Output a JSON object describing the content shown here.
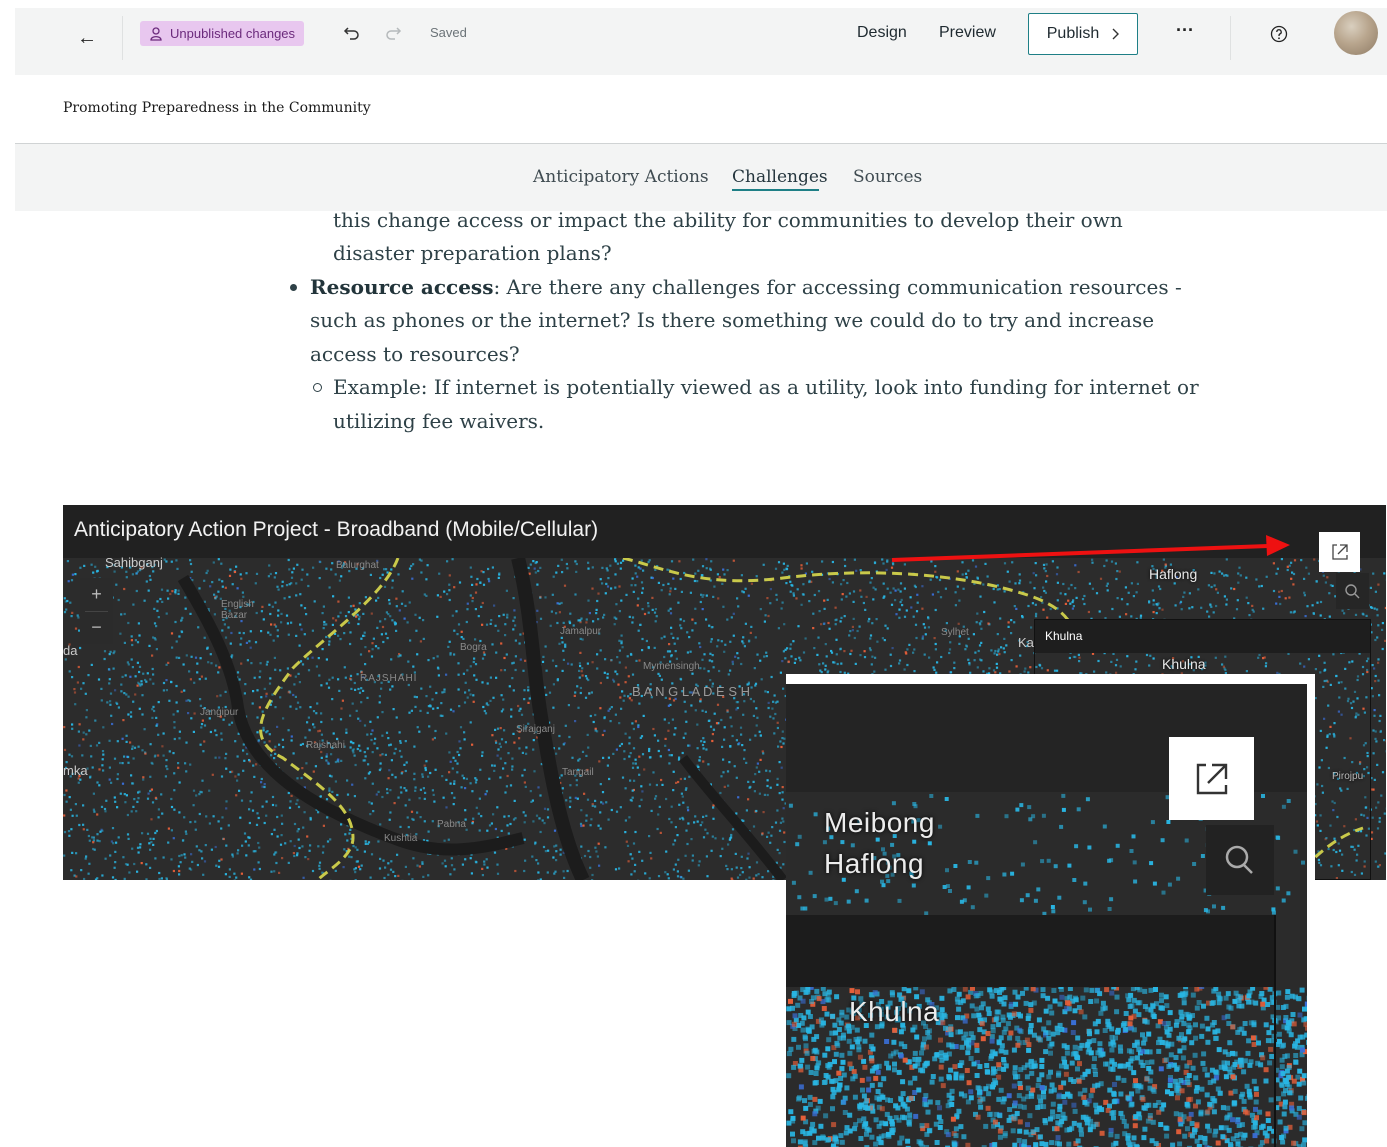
{
  "toolbar": {
    "back_icon": "arrow-left-icon",
    "unpublished_label": "Unpublished changes",
    "saved_label": "Saved",
    "design_label": "Design",
    "preview_label": "Preview",
    "publish_label": "Publish",
    "more_icon": "ellipsis-icon",
    "help_icon": "question-circle-icon"
  },
  "story": {
    "title": "Promoting Preparedness in the Community",
    "tabs": [
      {
        "label": "Anticipatory Actions",
        "active": false
      },
      {
        "label": "Challenges",
        "active": true
      },
      {
        "label": "Sources",
        "active": false
      }
    ]
  },
  "content": {
    "line1": "this change access or impact the ability for communities to develop their own",
    "line2": "disaster preparation plans?",
    "resource_term": "Resource access",
    "resource_line1": ": Are there any challenges for accessing communication resources -",
    "resource_line2": "such as phones or the internet? Is there something we could do to try and increase",
    "resource_line3": "access to resources?",
    "example_line1": "Example: If internet is potentially viewed as a utility, look into funding for internet or",
    "example_line2": "utilizing fee waivers."
  },
  "map": {
    "title": "Anticipatory Action Project - Broadband (Mobile/Cellular)",
    "zoom_in": "+",
    "zoom_out": "−",
    "popup_title": "Khulna",
    "labels": {
      "sahibganj": "Sahibganj",
      "balurghat": "Balurghat",
      "english_bazar": "English Bazar",
      "jamalpur": "Jamalpur",
      "bogra": "Bogra",
      "rajshahi_div": "RAJSHAHI",
      "mymensingh": "Mymensingh",
      "bangladesh": "B A N G L A D E S H",
      "sylhet": "Sylhet",
      "meibong": "Meibong",
      "haflong": "Haflong",
      "khulna": "Khulna",
      "jangipur": "Jangipur",
      "rajshahi": "Rajshahi",
      "sirajganj": "Sirajganj",
      "tangail": "Tangail",
      "kushtia": "Kushtia",
      "pabna": "Pabna",
      "pirojpur": "Pirojpu",
      "da": "da",
      "mka": "mka",
      "ka": "Ka"
    }
  },
  "inset": {
    "meibong": "Meibong",
    "haflong": "Haflong",
    "khulna": "Khulna"
  },
  "colors": {
    "accent": "#1e7f86",
    "unpublished_bg": "#e8c7ef",
    "map_cyan": "#29b6e3",
    "map_orange": "#e8603a",
    "border_yellow": "#c9c94a",
    "arrow_red": "#ee1111"
  }
}
